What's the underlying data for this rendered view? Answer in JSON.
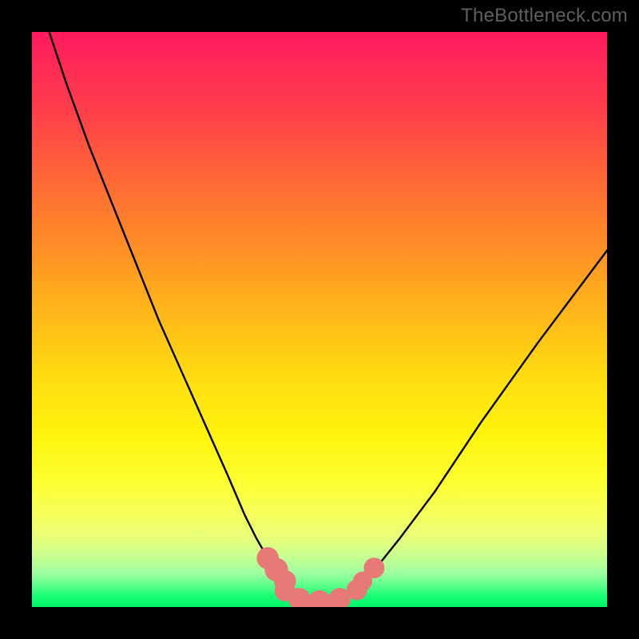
{
  "watermark": "TheBottleneck.com",
  "colors": {
    "curve_stroke": "#000000",
    "marker_fill": "#e77a76",
    "marker_stroke": "#c85a56",
    "frame": "#000000"
  },
  "chart_data": {
    "type": "line",
    "title": "",
    "xlabel": "",
    "ylabel": "",
    "xlim": [
      0,
      100
    ],
    "ylim": [
      0,
      100
    ],
    "grid": false,
    "legend": false,
    "series": [
      {
        "name": "curve",
        "x": [
          3,
          6,
          10,
          14,
          18,
          22,
          26,
          30,
          34,
          37,
          39,
          41,
          43,
          45,
          47,
          49,
          51,
          53,
          55,
          57,
          60,
          64,
          70,
          78,
          88,
          100
        ],
        "y": [
          100,
          91,
          80,
          70,
          60,
          50,
          41,
          32,
          23,
          16,
          12,
          8.5,
          5.8,
          3.5,
          2.0,
          1.2,
          1.0,
          1.2,
          2.0,
          3.5,
          7.0,
          12,
          20,
          32,
          46,
          62
        ]
      }
    ],
    "markers": [
      {
        "x": 41.0,
        "y": 8.5,
        "r": 1.6
      },
      {
        "x": 42.5,
        "y": 6.5,
        "r": 1.7
      },
      {
        "x": 44.0,
        "y": 4.5,
        "r": 1.6
      },
      {
        "x": 44.0,
        "y": 2.8,
        "r": 1.5
      },
      {
        "x": 46.5,
        "y": 1.4,
        "r": 1.6
      },
      {
        "x": 50.0,
        "y": 1.0,
        "r": 1.6
      },
      {
        "x": 53.5,
        "y": 1.4,
        "r": 1.6
      },
      {
        "x": 56.5,
        "y": 3.0,
        "r": 1.5
      },
      {
        "x": 57.5,
        "y": 4.5,
        "r": 1.4
      },
      {
        "x": 59.5,
        "y": 6.8,
        "r": 1.5
      }
    ],
    "flat_segment": {
      "x0": 46,
      "x1": 54,
      "y": 1.0,
      "thickness": 2.2
    }
  }
}
